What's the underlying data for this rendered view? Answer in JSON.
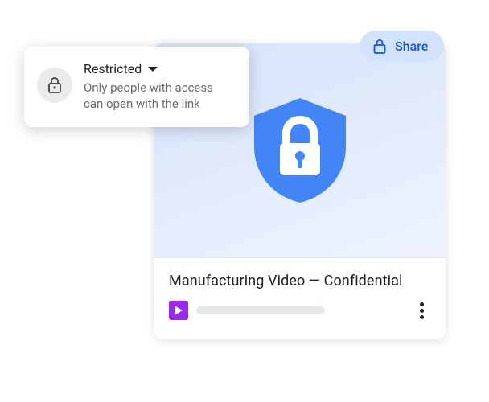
{
  "share": {
    "label": "Share"
  },
  "file": {
    "title": "Manufacturing Video — Confidential"
  },
  "popover": {
    "title": "Restricted",
    "description": "Only people with access can open with the link"
  }
}
